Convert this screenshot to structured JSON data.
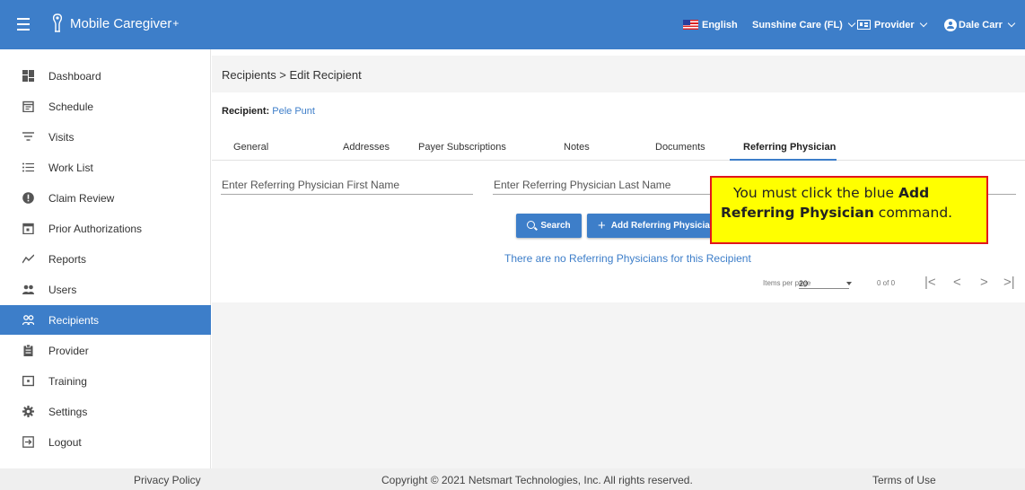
{
  "app": {
    "name": "Mobile Caregiver",
    "name_suffix": "+"
  },
  "topnav": {
    "language": "English",
    "organization": "Sunshine Care (FL)",
    "role": "Provider",
    "user": "Dale Carr"
  },
  "sidebar": {
    "items": [
      {
        "label": "Dashboard",
        "icon": "dashboard-icon"
      },
      {
        "label": "Schedule",
        "icon": "schedule-icon"
      },
      {
        "label": "Visits",
        "icon": "visits-icon"
      },
      {
        "label": "Work List",
        "icon": "work-list-icon"
      },
      {
        "label": "Claim Review",
        "icon": "claim-review-icon"
      },
      {
        "label": "Prior Authorizations",
        "icon": "calendar-icon"
      },
      {
        "label": "Reports",
        "icon": "reports-icon"
      },
      {
        "label": "Users",
        "icon": "users-icon"
      },
      {
        "label": "Recipients",
        "icon": "recipients-icon"
      },
      {
        "label": "Provider",
        "icon": "provider-icon"
      },
      {
        "label": "Training",
        "icon": "training-icon"
      },
      {
        "label": "Settings",
        "icon": "settings-icon"
      },
      {
        "label": "Logout",
        "icon": "logout-icon"
      }
    ],
    "active": "Recipients"
  },
  "main": {
    "breadcrumb": "Recipients > Edit Recipient",
    "recipient_label": "Recipient:",
    "recipient_name": "Pele Punt",
    "tabs": [
      "General",
      "Addresses",
      "Payer Subscriptions",
      "Notes",
      "Documents",
      "Referring Physician"
    ],
    "active_tab": "Referring Physician",
    "first_name_placeholder": "Enter Referring Physician First Name",
    "last_name_placeholder": "Enter Referring Physician Last Name",
    "search_button": "Search",
    "add_button": "Add Referring Physician",
    "empty_message": "There are no Referring Physicians for this Recipient",
    "pager": {
      "items_per_page_label": "Items per page",
      "items_per_page_value": "20",
      "range": "0 of 0"
    }
  },
  "callout": {
    "text_before": "You must click the blue ",
    "bold_1": "Add",
    "bold_2": "Referring Physician",
    "text_after": " command."
  },
  "footer": {
    "privacy": "Privacy Policy",
    "copyright": "Copyright © 2021 Netsmart Technologies, Inc. All rights reserved.",
    "terms": "Terms of Use"
  },
  "colors": {
    "brand_blue": "#3d7ec9",
    "callout_yellow": "#ffff00",
    "callout_border": "#e2161b"
  }
}
